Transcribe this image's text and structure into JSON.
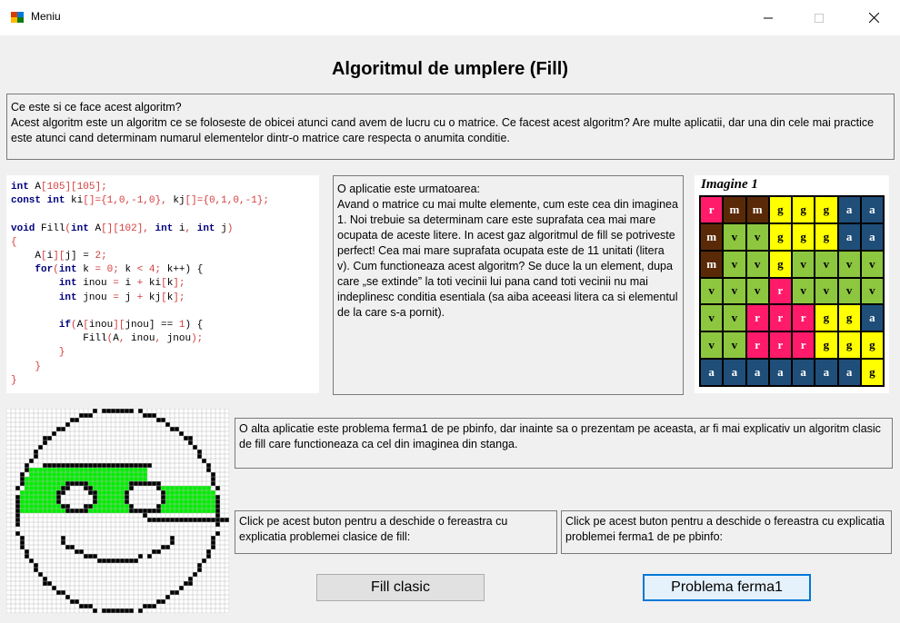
{
  "window": {
    "title": "Meniu",
    "icon": "app-icon",
    "controls": [
      "minimize-icon",
      "maximize-icon",
      "close-icon"
    ]
  },
  "page_title": "Algoritmul de umplere (Fill)",
  "intro_text": "Ce este si ce face acest algoritm?\nAcest algoritm este un algoritm ce se foloseste de obicei atunci cand avem de lucru cu o matrice. Ce facest acest algoritm? Are multe aplicatii, dar una din cele mai practice este atunci cand determinam numarul elementelor dintr-o matrice care respecta o anumita conditie.",
  "code_lines": [
    "int A[105][105];",
    "const int ki[]={1,0,-1,0}, kj[]={0,1,0,-1};",
    "",
    "void Fill(int A[][102], int i, int j)",
    "{",
    "    A[i][j] = 2;",
    "    for(int k = 0; k < 4; k++) {",
    "        int inou = i + ki[k];",
    "        int jnou = j + kj[k];",
    "",
    "        if(A[inou][jnou] == 1) {",
    "            Fill(A, inou, jnou);",
    "        }",
    "    }",
    "}"
  ],
  "application_text": "O aplicatie este urmatoarea:\nAvand o matrice cu mai multe elemente, cum este cea din imaginea 1. Noi trebuie sa determinam care este suprafata cea mai mare ocupata de aceste litere. In acest gaz algoritmul de fill se potriveste perfect! Cea mai mare suprafata ocupata este de 11 unitati (litera v). Cum functioneaza acest algoritm? Se duce la un element, dupa care „se extinde” la toti vecinii lui pana cand toti vecinii nu mai indeplinesc conditia esentiala (sa aiba aceeasi litera ca si elementul de la care s-a pornit).",
  "image1": {
    "caption": "Imagine 1",
    "colors": {
      "r": "#ff1a6a",
      "m": "#5a2a08",
      "g": "#ffff00",
      "a": "#1f4e79",
      "v": "#8dc63f"
    },
    "text_colors": {
      "r": "#ffffff",
      "m": "#ffffff",
      "g": "#000000",
      "a": "#ffffff",
      "v": "#000000"
    },
    "grid": [
      [
        "r",
        "m",
        "m",
        "g",
        "g",
        "g",
        "a",
        "a"
      ],
      [
        "m",
        "v",
        "v",
        "g",
        "g",
        "g",
        "a",
        "a"
      ],
      [
        "m",
        "v",
        "v",
        "g",
        "v",
        "v",
        "v",
        "v"
      ],
      [
        "v",
        "v",
        "v",
        "r",
        "v",
        "v",
        "v",
        "v"
      ],
      [
        "v",
        "v",
        "r",
        "r",
        "r",
        "g",
        "g",
        "a"
      ],
      [
        "v",
        "v",
        "r",
        "r",
        "r",
        "g",
        "g",
        "g"
      ],
      [
        "a",
        "a",
        "a",
        "a",
        "a",
        "a",
        "a",
        "g"
      ]
    ]
  },
  "ferma_text": "O alta aplicatie este problema ferma1 de pe pbinfo, dar inainte sa o prezentam pe aceasta, ar fi mai explicativ un algoritm clasic de fill care functioneaza ca cel din imaginea din stanga.",
  "clasic_note": "Click pe acest buton pentru a deschide o fereastra cu explicatia problemei clasice de fill:",
  "ferma_note": "Click pe acest buton pentru a deschide o fereastra cu explicatia problemei ferma1 de pe pbinfo:",
  "buttons": {
    "fill_clasic": "Fill clasic",
    "problema_ferma": "Problema ferma1"
  },
  "pixel_art": {
    "fill_color": "#00ee00",
    "outline_color": "#000000"
  }
}
